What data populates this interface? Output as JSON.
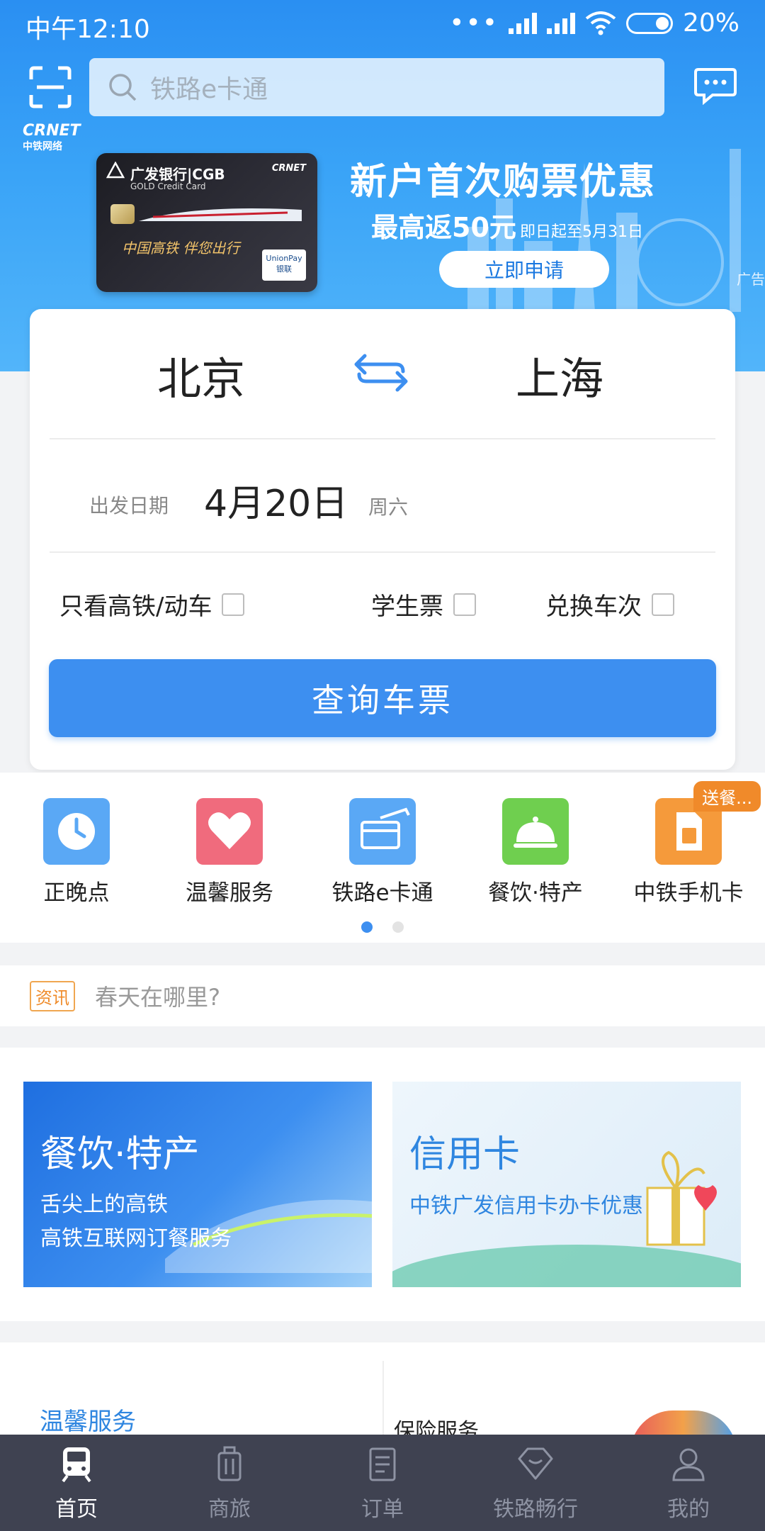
{
  "status_bar": {
    "time": "中午12:10",
    "dots": "•••",
    "battery": "20%"
  },
  "search": {
    "placeholder": "铁路e卡通"
  },
  "banner": {
    "brand": "CRNET",
    "brand_sub": "中铁网络",
    "card_bank": "广发银行|CGB",
    "card_tier": "GOLD Credit Card",
    "card_slogan": "中国高铁 伴您出行",
    "card_unionpay": "UnionPay 银联",
    "title": "新户首次购票优惠",
    "subtitle_main": "最高返50元",
    "subtitle_note": "即日起至5月31日",
    "button": "立即申请",
    "ad_tag": "广告"
  },
  "query": {
    "from_city": "北京",
    "to_city": "上海",
    "date_label": "出发日期",
    "date_value": "4月20日",
    "date_weekday": "周六",
    "options": [
      "只看高铁/动车",
      "学生票",
      "兑换车次"
    ],
    "submit": "查询车票"
  },
  "shortcuts": [
    {
      "label": "正晚点",
      "icon": "clock-icon",
      "color": "#5aa8f5"
    },
    {
      "label": "温馨服务",
      "icon": "heart-icon",
      "color": "#f06b7d"
    },
    {
      "label": "铁路e卡通",
      "icon": "card-icon",
      "color": "#5aa8f5"
    },
    {
      "label": "餐饮·特产",
      "icon": "service-bell-icon",
      "color": "#6fcf4f"
    },
    {
      "label": "中铁手机卡",
      "icon": "sim-card-icon",
      "color": "#f59a3b",
      "badge": "送餐..."
    }
  ],
  "news": {
    "tag": "资讯",
    "text": "春天在哪里?"
  },
  "promos": {
    "food": {
      "title": "餐饮·特产",
      "line1": "舌尖上的高铁",
      "line2": "高铁互联网订餐服务"
    },
    "credit": {
      "title": "信用卡",
      "line1": "中铁广发信用卡办卡优惠"
    }
  },
  "services": {
    "left": "温馨服务",
    "right": "保险服务"
  },
  "tabs": [
    "首页",
    "商旅",
    "订单",
    "铁路畅行",
    "我的"
  ],
  "colors": {
    "primary": "#3d8ff0",
    "header": "#2a8ff2",
    "tabbar": "#3f4251",
    "badge": "#f08a2a"
  }
}
